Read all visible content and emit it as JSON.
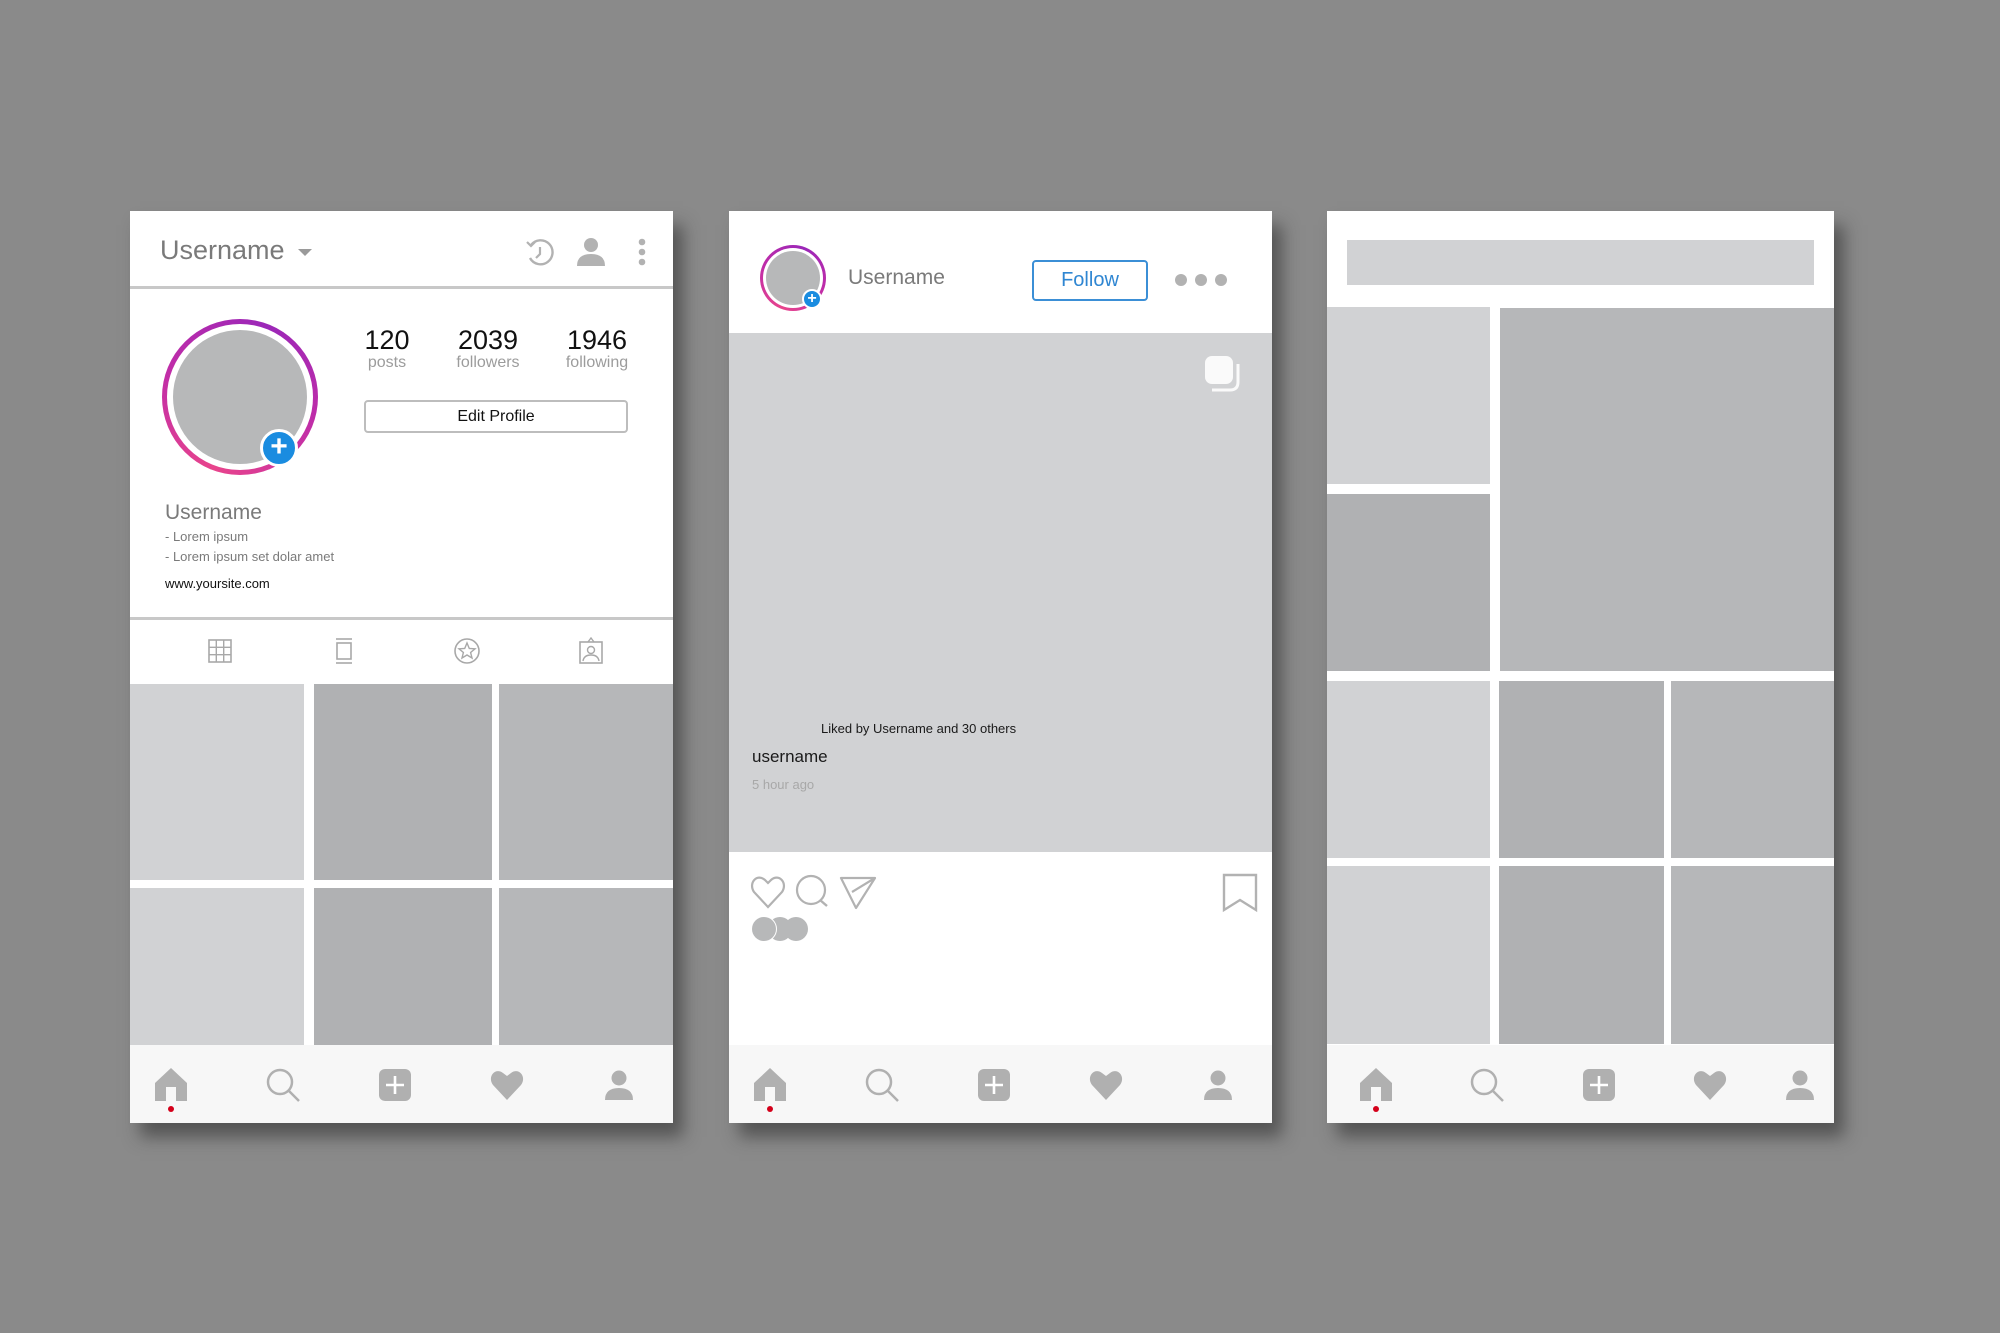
{
  "background_color": "#8a8a8a",
  "colors": {
    "accent_blue": "#1a8ce0",
    "follow_blue": "#2f86d2",
    "ring_pink": "#e8448c",
    "ring_purple": "#9b27b8",
    "icon_gray": "#b2b2b2",
    "active_dot": "#d4001a"
  },
  "profile_screen": {
    "header": {
      "username": "Username",
      "icons": [
        "chevron-down-icon",
        "history-icon",
        "person-icon",
        "more-vertical-icon"
      ]
    },
    "stats": [
      {
        "value": "120",
        "label": "posts"
      },
      {
        "value": "2039",
        "label": "followers"
      },
      {
        "value": "1946",
        "label": "following"
      }
    ],
    "edit_profile_label": "Edit Profile",
    "bio": {
      "name": "Username",
      "lines": [
        "- Lorem ipsum",
        "- Lorem ipsum set dolar amet"
      ],
      "website": "www.yoursite.com"
    },
    "tabs": [
      "grid-icon",
      "feed-icon",
      "star-icon",
      "tagged-icon"
    ],
    "grid_tiles": 6
  },
  "post_screen": {
    "username": "Username",
    "follow_label": "Follow",
    "more_icon": "more-horizontal-icon",
    "multi_image_icon": "multi-image-icon",
    "actions": [
      "heart-icon",
      "comment-icon",
      "send-icon",
      "bookmark-icon"
    ],
    "liked_by": "Liked by Username and 30 others",
    "caption_username": "username",
    "timestamp": "5 hour ago"
  },
  "explore_screen": {
    "search_bar": "",
    "tiles": 9
  },
  "bottom_nav": [
    "home-icon",
    "search-icon",
    "add-icon",
    "heart-icon",
    "profile-icon"
  ]
}
